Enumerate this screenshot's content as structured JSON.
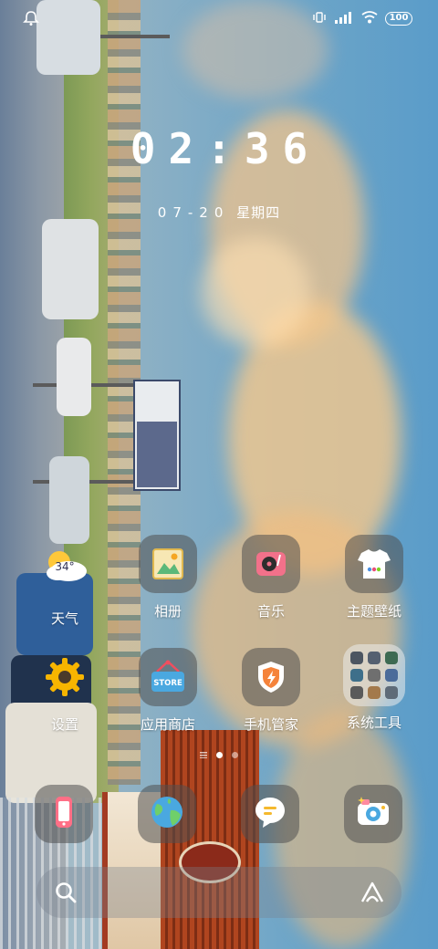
{
  "status_bar": {
    "left_icon": "notification-bell-icon",
    "right_icons": [
      "vibrate-icon",
      "signal-icon",
      "wifi-icon"
    ],
    "battery_level": "100"
  },
  "clock": {
    "time": "02:36",
    "date": "07-20",
    "weekday": "星期四"
  },
  "weather": {
    "temperature": "34°",
    "label": "天气",
    "icon": "sun-cloud-icon"
  },
  "apps_row1": [
    {
      "label": "相册",
      "icon": "gallery-icon"
    },
    {
      "label": "音乐",
      "icon": "music-icon"
    },
    {
      "label": "主题壁纸",
      "icon": "theme-icon"
    }
  ],
  "apps_row2": [
    {
      "label": "设置",
      "icon": "gear-icon"
    },
    {
      "label": "应用商店",
      "icon": "store-icon",
      "badge_text": "STORE"
    },
    {
      "label": "手机管家",
      "icon": "shield-icon"
    },
    {
      "label": "系统工具",
      "icon": "folder-icon"
    }
  ],
  "dock": [
    {
      "icon": "phone-icon"
    },
    {
      "icon": "browser-globe-icon"
    },
    {
      "icon": "messages-icon"
    },
    {
      "icon": "camera-icon"
    }
  ],
  "page_indicator": {
    "pages": 2,
    "current": 1
  },
  "search": {
    "icon": "search-icon",
    "assistant_icon": "assistant-icon"
  }
}
